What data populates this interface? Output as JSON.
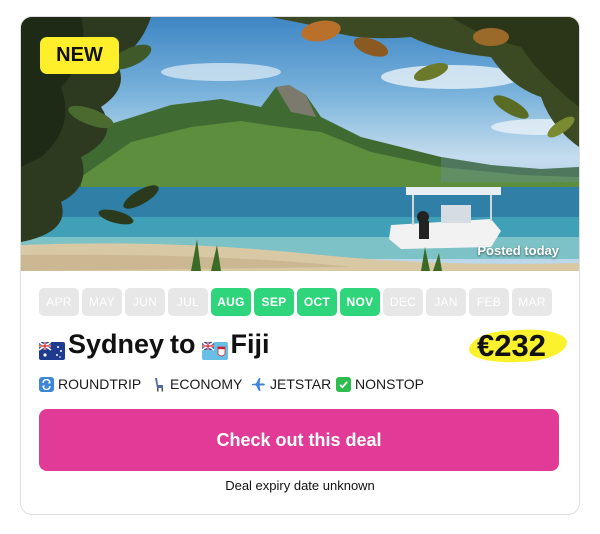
{
  "badge": {
    "label": "NEW"
  },
  "photo": {
    "posted_label": "Posted today"
  },
  "months": [
    {
      "label": "APR",
      "active": false
    },
    {
      "label": "MAY",
      "active": false
    },
    {
      "label": "JUN",
      "active": false
    },
    {
      "label": "JUL",
      "active": false
    },
    {
      "label": "AUG",
      "active": true
    },
    {
      "label": "SEP",
      "active": true
    },
    {
      "label": "OCT",
      "active": true
    },
    {
      "label": "NOV",
      "active": true
    },
    {
      "label": "DEC",
      "active": false
    },
    {
      "label": "JAN",
      "active": false
    },
    {
      "label": "FEB",
      "active": false
    },
    {
      "label": "MAR",
      "active": false
    }
  ],
  "route": {
    "origin": "Sydney",
    "connector": "to",
    "destination": "Fiji",
    "origin_flag": "australia-flag-icon",
    "destination_flag": "fiji-flag-icon"
  },
  "price": {
    "value": "€232",
    "highlight_color": "#fbf22d"
  },
  "tags": [
    {
      "icon": "repeat-icon",
      "label": "ROUNDTRIP"
    },
    {
      "icon": "seat-icon",
      "label": "ECONOMY"
    },
    {
      "icon": "airplane-icon",
      "label": "JETSTAR"
    },
    {
      "icon": "checkmark-icon",
      "label": "NONSTOP"
    }
  ],
  "cta": {
    "label": "Check out this deal",
    "color": "#e13b97"
  },
  "expiry": {
    "label": "Deal expiry date unknown"
  },
  "colors": {
    "active_month": "#2fd57a",
    "inactive_month": "#e7e7e7",
    "badge": "#ffef2a"
  }
}
